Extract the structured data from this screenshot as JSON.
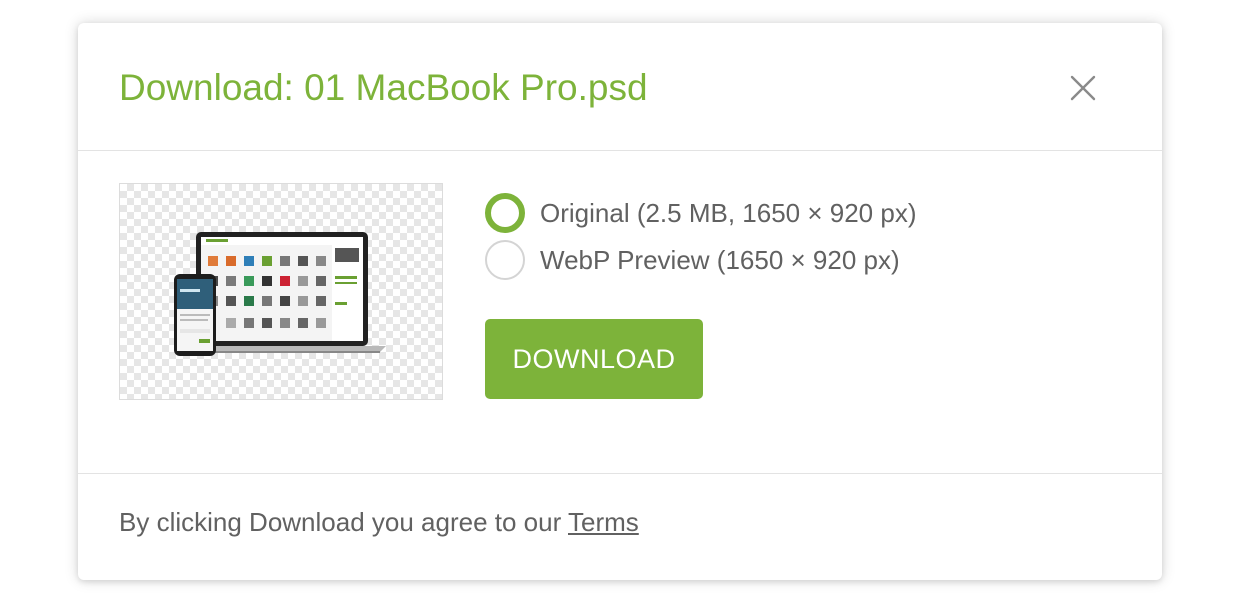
{
  "modal": {
    "title": "Download: 01 MacBook Pro.psd",
    "close_icon": "close-icon",
    "preview_image": "macbook-iphone-mockup-thumbnail",
    "options": [
      {
        "label": "Original (2.5 MB, 1650 × 920 px)",
        "selected": true
      },
      {
        "label": "WebP Preview (1650 × 920 px)",
        "selected": false
      }
    ],
    "download_label": "DOWNLOAD",
    "footer": {
      "text": "By clicking Download you agree to our ",
      "terms_link": "Terms"
    }
  },
  "colors": {
    "accent": "#7db33a",
    "text": "#616161",
    "divider": "#e3e3e3"
  }
}
